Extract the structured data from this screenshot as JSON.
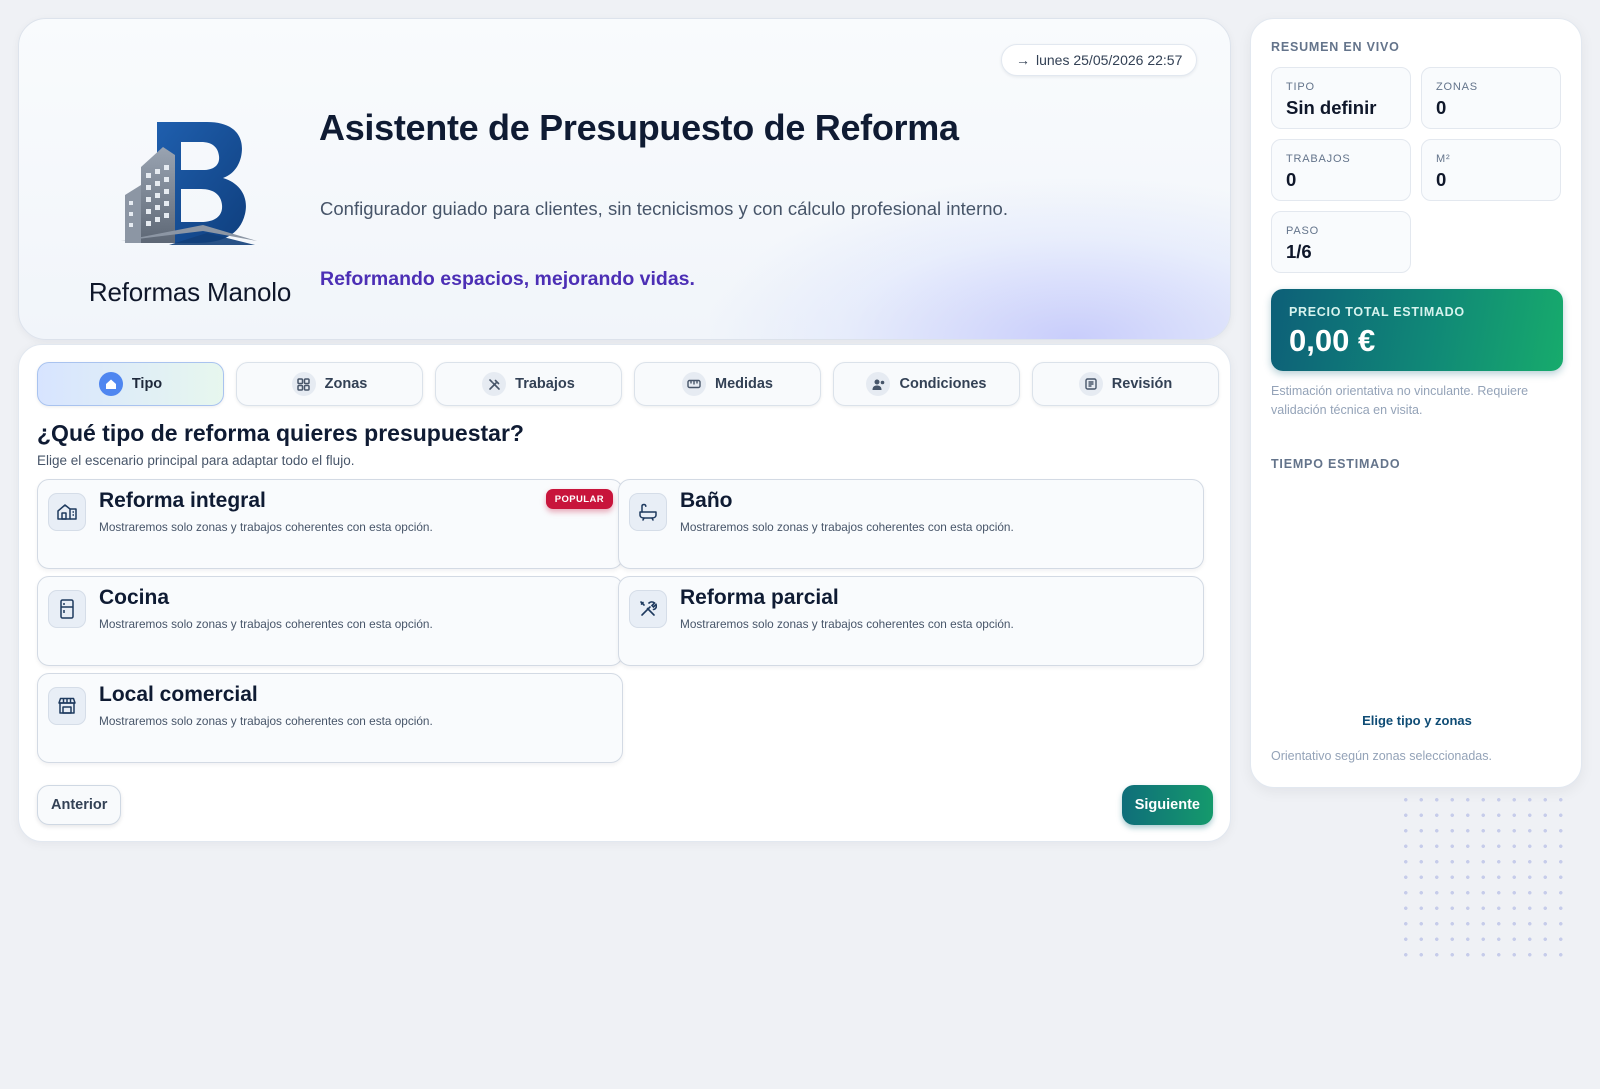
{
  "header": {
    "datetime_arrow": "→",
    "datetime": "lunes 25/05/2026 22:57",
    "brand_name": "Reformas Manolo",
    "title": "Asistente de Presupuesto de Reforma",
    "subtitle": "Configurador guiado para clientes, sin tecnicismos y con cálculo profesional interno.",
    "slogan": "Reformando espacios, mejorando vidas.",
    "logo_icon": "building-b-logo-icon"
  },
  "tabs": [
    {
      "label": "Tipo",
      "icon": "home-icon",
      "active": true
    },
    {
      "label": "Zonas",
      "icon": "grid-icon",
      "active": false
    },
    {
      "label": "Trabajos",
      "icon": "tools-icon",
      "active": false
    },
    {
      "label": "Medidas",
      "icon": "ruler-icon",
      "active": false
    },
    {
      "label": "Condiciones",
      "icon": "user-settings-icon",
      "active": false
    },
    {
      "label": "Revisión",
      "icon": "document-icon",
      "active": false
    }
  ],
  "step": {
    "question": "¿Qué tipo de reforma quieres presupuestar?",
    "hint": "Elige el escenario principal para adaptar todo el flujo."
  },
  "options": [
    {
      "title": "Reforma integral",
      "desc": "Mostraremos solo zonas y trabajos coherentes con esta opción.",
      "badge": "POPULAR",
      "icon": "house-icon"
    },
    {
      "title": "Baño",
      "desc": "Mostraremos solo zonas y trabajos coherentes con esta opción.",
      "badge": "",
      "icon": "bathtub-icon"
    },
    {
      "title": "Cocina",
      "desc": "Mostraremos solo zonas y trabajos coherentes con esta opción.",
      "badge": "",
      "icon": "fridge-icon"
    },
    {
      "title": "Reforma parcial",
      "desc": "Mostraremos solo zonas y trabajos coherentes con esta opción.",
      "badge": "",
      "icon": "tools-icon"
    },
    {
      "title": "Local comercial",
      "desc": "Mostraremos solo zonas y trabajos coherentes con esta opción.",
      "badge": "",
      "icon": "store-icon"
    }
  ],
  "nav": {
    "prev_label": "Anterior",
    "next_label": "Siguiente"
  },
  "summary": {
    "heading": "RESUMEN EN VIVO",
    "stats": [
      {
        "label": "TIPO",
        "value": "Sin definir"
      },
      {
        "label": "ZONAS",
        "value": "0"
      },
      {
        "label": "TRABAJOS",
        "value": "0"
      },
      {
        "label": "M²",
        "value": "0"
      },
      {
        "label": "PASO",
        "value": "1/6"
      }
    ],
    "price_label": "PRECIO TOTAL ESTIMADO",
    "price_value": "0,00 €",
    "disclaimer": "Estimación orientativa no vinculante. Requiere validación técnica en visita.",
    "time_heading": "TIEMPO ESTIMADO",
    "time_cta": "Elige tipo y zonas",
    "time_note": "Orientativo según zonas seleccionadas."
  },
  "colors": {
    "accent_blue": "#4f86f0",
    "brand_navy": "#0f1b33",
    "slogan_purple": "#4c2fb5",
    "badge_red": "#c8143b",
    "price_gradient_start": "#0d5f78",
    "price_gradient_end": "#17ab6c"
  }
}
